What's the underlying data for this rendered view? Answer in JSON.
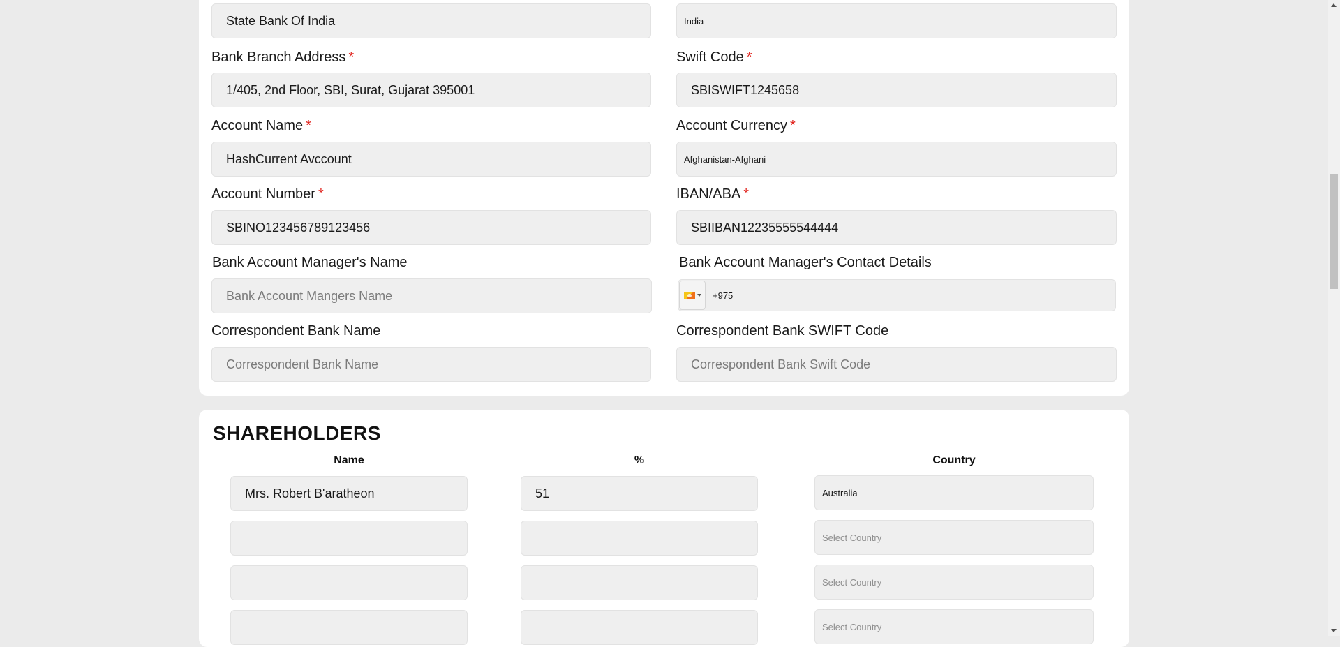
{
  "bank": {
    "bank_name": {
      "value": "State Bank Of India"
    },
    "country": {
      "value": "India"
    },
    "branch_address": {
      "label": "Bank Branch Address",
      "value": "1/405, 2nd Floor, SBI, Surat, Gujarat 395001"
    },
    "swift_code": {
      "label": "Swift Code",
      "value": "SBISWIFT1245658"
    },
    "account_name": {
      "label": "Account Name",
      "value": "HashCurrent Avccount"
    },
    "account_currency": {
      "label": "Account Currency",
      "value": "Afghanistan-Afghani"
    },
    "account_number": {
      "label": "Account Number",
      "value": "SBINO123456789123456"
    },
    "iban_aba": {
      "label": "IBAN/ABA",
      "value": "SBIIBAN12235555544444"
    },
    "manager_name": {
      "label": "Bank Account Manager's Name",
      "placeholder": "Bank Account Mangers Name"
    },
    "manager_contact": {
      "label": "Bank Account Manager's Contact Details",
      "value": "+975",
      "flag_icon": "bhutan-flag-icon"
    },
    "correspondent_name": {
      "label": "Correspondent Bank Name",
      "placeholder": "Correspondent Bank Name"
    },
    "correspondent_swift": {
      "label": "Correspondent Bank SWIFT Code",
      "placeholder": "Correspondent Bank Swift Code"
    },
    "required_mark": "*"
  },
  "shareholders": {
    "title": "SHAREHOLDERS",
    "columns": {
      "name": "Name",
      "percent": "%",
      "country": "Country"
    },
    "rows": [
      {
        "name": "Mrs. Robert B'aratheon",
        "percent": "51",
        "country": "Australia"
      },
      {
        "name": "",
        "percent": "",
        "country": "Select Country"
      },
      {
        "name": "",
        "percent": "",
        "country": "Select Country"
      },
      {
        "name": "",
        "percent": "",
        "country": "Select Country"
      }
    ]
  },
  "colors": {
    "required": "#e0201a",
    "field_bg": "#efefef",
    "page_bg": "#ebebeb"
  }
}
